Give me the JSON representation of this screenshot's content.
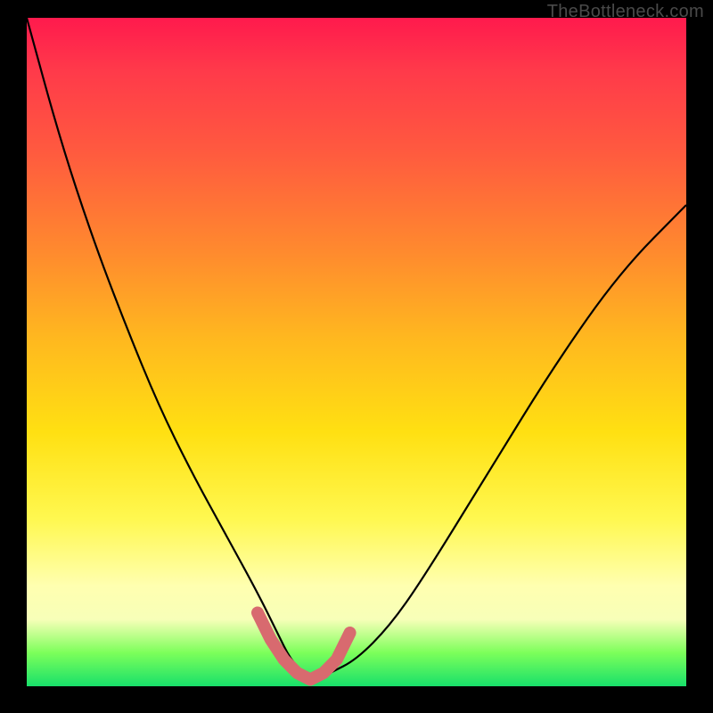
{
  "watermark": "TheBottleneck.com",
  "colors": {
    "background": "#000000",
    "curve": "#000000",
    "marker": "#d86a6f",
    "gradient_top": "#ff1a4d",
    "gradient_bottom": "#18e06a"
  },
  "chart_data": {
    "type": "line",
    "title": "",
    "xlabel": "",
    "ylabel": "",
    "xlim": [
      0,
      100
    ],
    "ylim": [
      0,
      100
    ],
    "series": [
      {
        "name": "bottleneck-curve",
        "x": [
          0,
          5,
          10,
          15,
          20,
          25,
          30,
          35,
          38,
          40,
          42,
          44,
          46,
          50,
          55,
          60,
          70,
          80,
          90,
          100
        ],
        "y": [
          100,
          82,
          67,
          54,
          42,
          32,
          23,
          14,
          8,
          4,
          2,
          1,
          2,
          4,
          9,
          16,
          32,
          48,
          62,
          72
        ]
      }
    ],
    "markers": {
      "name": "highlighted-region",
      "x": [
        35,
        37,
        39,
        41,
        43,
        45,
        47,
        49
      ],
      "y": [
        11,
        7,
        4,
        2,
        1,
        2,
        4,
        8
      ]
    },
    "annotations": [
      {
        "text": "TheBottleneck.com",
        "position": "top-right"
      }
    ]
  }
}
